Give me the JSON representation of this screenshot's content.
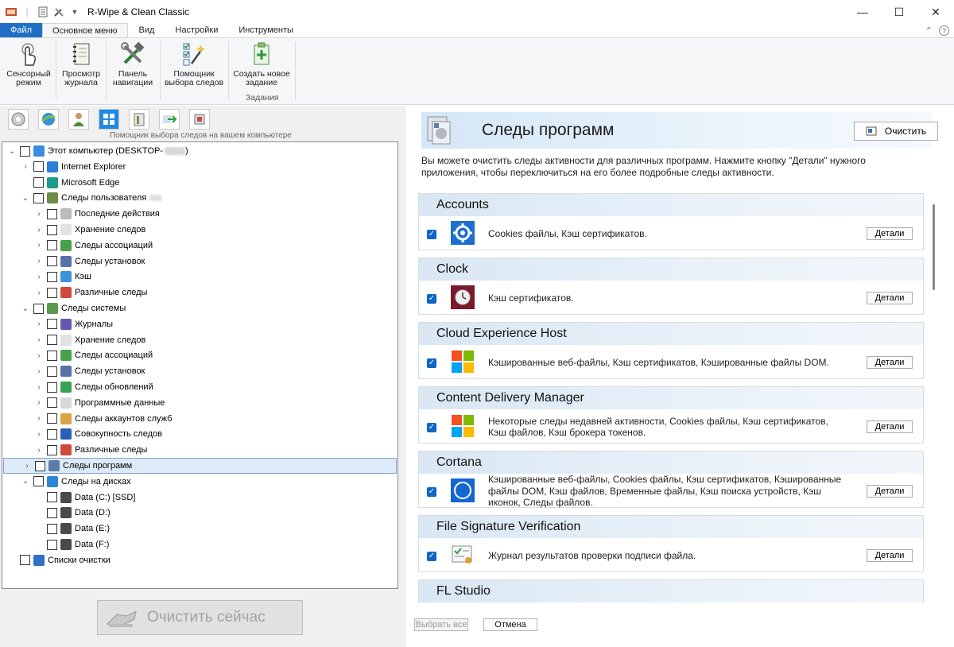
{
  "window": {
    "title": "R-Wipe & Clean Classic"
  },
  "ribbon": {
    "tabs": [
      "Файл",
      "Основное меню",
      "Вид",
      "Настройки",
      "Инструменты"
    ],
    "buttons": [
      {
        "line1": "Сенсорный",
        "line2": "режим",
        "icon": "touch-hand-icon"
      },
      {
        "line1": "Просмотр",
        "line2": "журнала",
        "icon": "log-notebook-icon"
      },
      {
        "line1": "Панель",
        "line2": "навигации",
        "icon": "tools-icon"
      },
      {
        "line1": "Помощник",
        "line2": "выбора следов",
        "icon": "wizard-checklist-icon"
      },
      {
        "line1": "Создать новое",
        "line2": "задание",
        "icon": "new-task-icon"
      }
    ],
    "group_label": "Задания"
  },
  "left": {
    "hint": "Помощник выбора следов на вашем компьютере",
    "tree": [
      {
        "label": "Этот компьютер (DESKTOP-",
        "level": 0,
        "arrow": "down",
        "icon_color": "#3a8dde"
      },
      {
        "label": "Internet Explorer",
        "level": 1,
        "arrow": "right",
        "icon_color": "#2a7fd8"
      },
      {
        "label": "Microsoft Edge",
        "level": 1,
        "arrow": "none",
        "icon_color": "#1c9c8a"
      },
      {
        "label": "Следы пользователя",
        "level": 1,
        "arrow": "down",
        "icon_color": "#6d8c4a"
      },
      {
        "label": "Последние действия",
        "level": 2,
        "arrow": "right",
        "icon_color": "#bbbbbb"
      },
      {
        "label": "Хранение следов",
        "level": 2,
        "arrow": "right",
        "icon_color": "#e2e2e2"
      },
      {
        "label": "Следы ассоциаций",
        "level": 2,
        "arrow": "right",
        "icon_color": "#49a04b"
      },
      {
        "label": "Следы установок",
        "level": 2,
        "arrow": "right",
        "icon_color": "#5872a8"
      },
      {
        "label": "Кэш",
        "level": 2,
        "arrow": "right",
        "icon_color": "#3b95d8"
      },
      {
        "label": "Различные следы",
        "level": 2,
        "arrow": "right",
        "icon_color": "#cf4a3a"
      },
      {
        "label": "Следы системы",
        "level": 1,
        "arrow": "down",
        "icon_color": "#5a9a4d"
      },
      {
        "label": "Журналы",
        "level": 2,
        "arrow": "right",
        "icon_color": "#6a55b0"
      },
      {
        "label": "Хранение следов",
        "level": 2,
        "arrow": "right",
        "icon_color": "#e2e2e2"
      },
      {
        "label": "Следы ассоциаций",
        "level": 2,
        "arrow": "right",
        "icon_color": "#49a04b"
      },
      {
        "label": "Следы установок",
        "level": 2,
        "arrow": "right",
        "icon_color": "#5872a8"
      },
      {
        "label": "Следы обновлений",
        "level": 2,
        "arrow": "right",
        "icon_color": "#3aa055"
      },
      {
        "label": "Программные данные",
        "level": 2,
        "arrow": "right",
        "icon_color": "#d9d9d9"
      },
      {
        "label": "Следы аккаунтов служб",
        "level": 2,
        "arrow": "right",
        "icon_color": "#d9a441"
      },
      {
        "label": "Совокупность следов",
        "level": 2,
        "arrow": "right",
        "icon_color": "#2c5fb8"
      },
      {
        "label": "Различные следы",
        "level": 2,
        "arrow": "right",
        "icon_color": "#cf4a3a"
      },
      {
        "label": "Следы программ",
        "level": 1,
        "arrow": "right",
        "icon_color": "#5b7da6",
        "selected": true
      },
      {
        "label": "Следы на дисках",
        "level": 1,
        "arrow": "down",
        "icon_color": "#2f86d6"
      },
      {
        "label": "Data (C:) [SSD]",
        "level": 2,
        "arrow": "none",
        "icon_color": "#4a4a4a"
      },
      {
        "label": "Data (D:)",
        "level": 2,
        "arrow": "none",
        "icon_color": "#4a4a4a"
      },
      {
        "label": "Data (E:)",
        "level": 2,
        "arrow": "none",
        "icon_color": "#4a4a4a"
      },
      {
        "label": "Data (F:)",
        "level": 2,
        "arrow": "none",
        "icon_color": "#4a4a4a"
      },
      {
        "label": "Списки очистки",
        "level": 0,
        "arrow": "none",
        "icon_color": "#2f6fc4"
      }
    ],
    "clean_now": "Очистить сейчас"
  },
  "right": {
    "title": "Следы программ",
    "clean_button": "Очистить",
    "description": "Вы можете очистить следы активности для различных программ. Нажмите кнопку \"Детали\" нужного приложения, чтобы переключиться на его более подробные следы активности.",
    "details_label": "Детали",
    "apps": [
      {
        "name": "Accounts",
        "desc": "Cookies файлы, Кэш сертификатов.",
        "icon": "gear-icon",
        "checked": true
      },
      {
        "name": "Clock",
        "desc": "Кэш сертификатов.",
        "icon": "clock-icon",
        "checked": true
      },
      {
        "name": "Cloud Experience Host",
        "desc": "Кэшированные веб-файлы, Кэш сертификатов, Кэшированные файлы DOM.",
        "icon": "windows-logo-icon",
        "checked": true
      },
      {
        "name": "Content Delivery Manager",
        "desc": "Некоторые следы недавней активности, Cookies файлы, Кэш сертификатов, Кэш файлов, Кэш брокера токенов.",
        "icon": "windows-logo-icon",
        "checked": true
      },
      {
        "name": "Cortana",
        "desc": "Кэшированные веб-файлы, Cookies файлы, Кэш сертификатов, Кэшированные файлы DOM, Кэш файлов, Временные файлы, Кэш поиска устройств, Кэш иконок, Следы файлов.",
        "icon": "cortana-ring-icon",
        "checked": true
      },
      {
        "name": "File Signature Verification",
        "desc": "Журнал результатов проверки подписи файла.",
        "icon": "certificate-icon",
        "checked": true
      },
      {
        "name": "FL Studio",
        "desc": "",
        "icon": "",
        "checked": true
      }
    ],
    "select_all": "Выбрать все",
    "cancel": "Отмена"
  }
}
